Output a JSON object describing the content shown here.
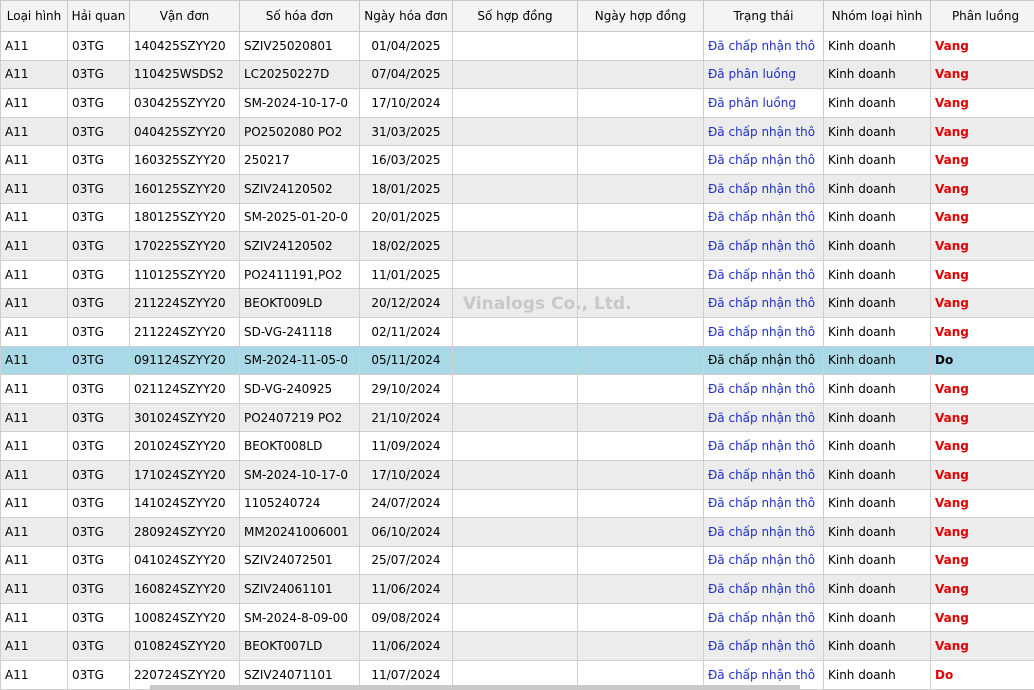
{
  "columns": [
    "Loại hình",
    "Hải quan",
    "Vận đơn",
    "Số hóa đơn",
    "Ngày hóa đơn",
    "Số hợp đồng",
    "Ngày hợp đồng",
    "Trạng thái",
    "Nhóm loại hình",
    "Phân luồng"
  ],
  "watermark": "Vinalogs Co., Ltd.",
  "selected_row": 11,
  "rows": [
    [
      "A11",
      "03TG",
      "140425SZYY20",
      "SZIV25020801",
      "01/04/2025",
      "",
      "",
      "Đã chấp nhận thô",
      "Kinh doanh",
      "Vang"
    ],
    [
      "A11",
      "03TG",
      "110425WSDS2",
      "LC20250227D",
      "07/04/2025",
      "",
      "",
      "Đã phân luồng",
      "Kinh doanh",
      "Vang"
    ],
    [
      "A11",
      "03TG",
      "030425SZYY20",
      "SM-2024-10-17-0",
      "17/10/2024",
      "",
      "",
      "Đã phân luồng",
      "Kinh doanh",
      "Vang"
    ],
    [
      "A11",
      "03TG",
      "040425SZYY20",
      "PO2502080 PO2",
      "31/03/2025",
      "",
      "",
      "Đã chấp nhận thô",
      "Kinh doanh",
      "Vang"
    ],
    [
      "A11",
      "03TG",
      "160325SZYY20",
      "250217",
      "16/03/2025",
      "",
      "",
      "Đã chấp nhận thô",
      "Kinh doanh",
      "Vang"
    ],
    [
      "A11",
      "03TG",
      "160125SZYY20",
      "SZIV24120502",
      "18/01/2025",
      "",
      "",
      "Đã chấp nhận thô",
      "Kinh doanh",
      "Vang"
    ],
    [
      "A11",
      "03TG",
      "180125SZYY20",
      "SM-2025-01-20-0",
      "20/01/2025",
      "",
      "",
      "Đã chấp nhận thô",
      "Kinh doanh",
      "Vang"
    ],
    [
      "A11",
      "03TG",
      "170225SZYY20",
      "SZIV24120502",
      "18/02/2025",
      "",
      "",
      "Đã chấp nhận thô",
      "Kinh doanh",
      "Vang"
    ],
    [
      "A11",
      "03TG",
      "110125SZYY20",
      "PO2411191,PO2",
      "11/01/2025",
      "",
      "",
      "Đã chấp nhận thô",
      "Kinh doanh",
      "Vang"
    ],
    [
      "A11",
      "03TG",
      "211224SZYY20",
      "BEOKT009LD",
      "20/12/2024",
      "",
      "",
      "Đã chấp nhận thô",
      "Kinh doanh",
      "Vang"
    ],
    [
      "A11",
      "03TG",
      "211224SZYY20",
      "SD-VG-241118",
      "02/11/2024",
      "",
      "",
      "Đã chấp nhận thô",
      "Kinh doanh",
      "Vang"
    ],
    [
      "A11",
      "03TG",
      "091124SZYY20",
      "SM-2024-11-05-0",
      "05/11/2024",
      "",
      "",
      "Đã chấp nhận thô",
      "Kinh doanh",
      "Do"
    ],
    [
      "A11",
      "03TG",
      "021124SZYY20",
      "SD-VG-240925",
      "29/10/2024",
      "",
      "",
      "Đã chấp nhận thô",
      "Kinh doanh",
      "Vang"
    ],
    [
      "A11",
      "03TG",
      "301024SZYY20",
      "PO2407219 PO2",
      "21/10/2024",
      "",
      "",
      "Đã chấp nhận thô",
      "Kinh doanh",
      "Vang"
    ],
    [
      "A11",
      "03TG",
      "201024SZYY20",
      "BEOKT008LD",
      "11/09/2024",
      "",
      "",
      "Đã chấp nhận thô",
      "Kinh doanh",
      "Vang"
    ],
    [
      "A11",
      "03TG",
      "171024SZYY20",
      "SM-2024-10-17-0",
      "17/10/2024",
      "",
      "",
      "Đã chấp nhận thô",
      "Kinh doanh",
      "Vang"
    ],
    [
      "A11",
      "03TG",
      "141024SZYY20",
      "1105240724",
      "24/07/2024",
      "",
      "",
      "Đã chấp nhận thô",
      "Kinh doanh",
      "Vang"
    ],
    [
      "A11",
      "03TG",
      "280924SZYY20",
      "MM20241006001",
      "06/10/2024",
      "",
      "",
      "Đã chấp nhận thô",
      "Kinh doanh",
      "Vang"
    ],
    [
      "A11",
      "03TG",
      "041024SZYY20",
      "SZIV24072501",
      "25/07/2024",
      "",
      "",
      "Đã chấp nhận thô",
      "Kinh doanh",
      "Vang"
    ],
    [
      "A11",
      "03TG",
      "160824SZYY20",
      "SZIV24061101",
      "11/06/2024",
      "",
      "",
      "Đã chấp nhận thô",
      "Kinh doanh",
      "Vang"
    ],
    [
      "A11",
      "03TG",
      "100824SZYY20",
      "SM-2024-8-09-00",
      "09/08/2024",
      "",
      "",
      "Đã chấp nhận thô",
      "Kinh doanh",
      "Vang"
    ],
    [
      "A11",
      "03TG",
      "010824SZYY20",
      "BEOKT007LD",
      "11/06/2024",
      "",
      "",
      "Đã chấp nhận thô",
      "Kinh doanh",
      "Vang"
    ],
    [
      "A11",
      "03TG",
      "220724SZYY20",
      "SZIV24071101",
      "11/07/2024",
      "",
      "",
      "Đã chấp nhận thô",
      "Kinh doanh",
      "Do"
    ]
  ]
}
